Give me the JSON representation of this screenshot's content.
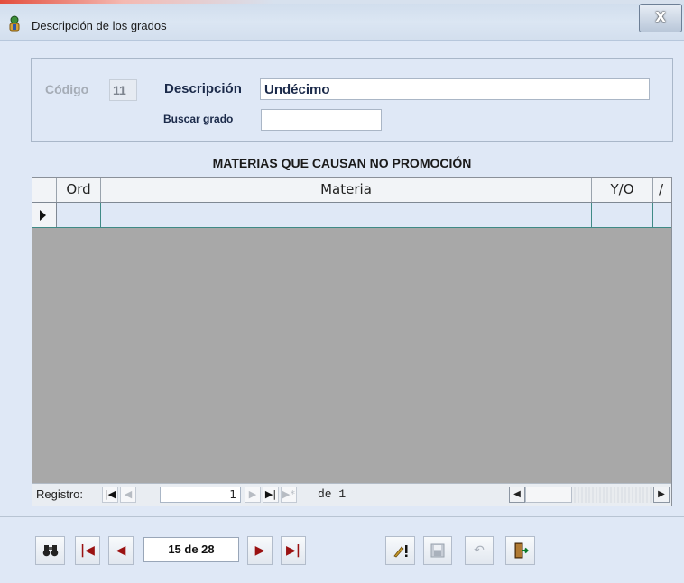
{
  "window": {
    "title": "Descripción de los grados",
    "close_glyph": "X",
    "icon": "teacher-globe-icon"
  },
  "header": {
    "codigo_label": "Código",
    "codigo_value": "11",
    "descripcion_label": "Descripción",
    "descripcion_value": "Undécimo",
    "buscar_label": "Buscar grado",
    "buscar_value": ""
  },
  "subform": {
    "title": "MATERIAS QUE CAUSAN NO PROMOCIÓN",
    "columns": [
      "Ord",
      "Materia",
      "Y/O",
      "/"
    ],
    "navigator": {
      "label": "Registro:",
      "current": "1",
      "of_text": "de 1"
    }
  },
  "toolbar": {
    "record_text": "15 de 28",
    "icons": [
      "binoculars-icon",
      "first-record-icon",
      "prev-record-icon",
      "next-record-icon",
      "last-record-icon",
      "edit-icon",
      "save-icon",
      "undo-icon",
      "exit-icon"
    ]
  },
  "colors": {
    "window_bg": "#dfe8f6",
    "grid_bg": "#a8a8a8",
    "nav_red": "#9a1111",
    "row_border": "#3f8a86"
  }
}
